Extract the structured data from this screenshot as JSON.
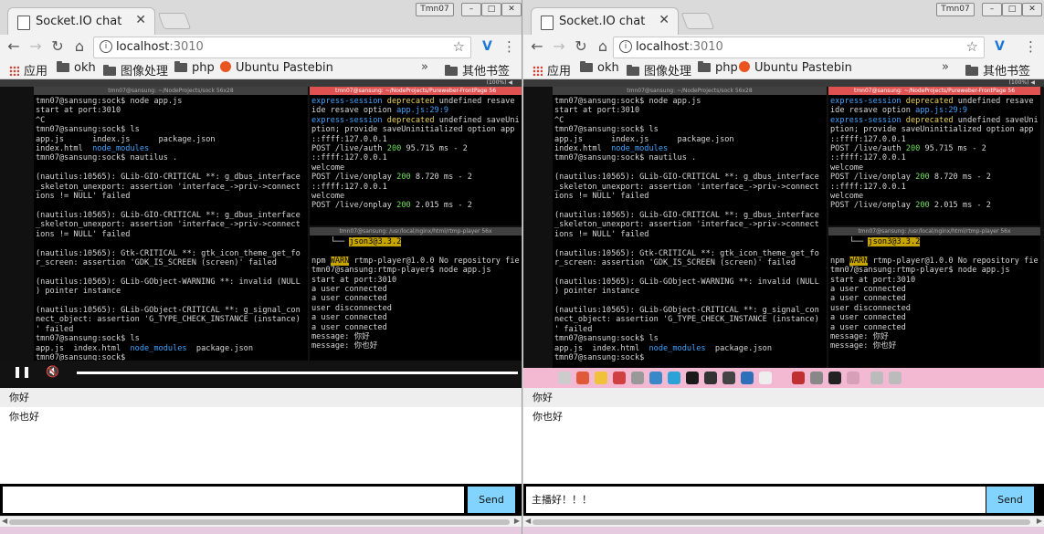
{
  "left": {
    "tab_title": "Socket.IO chat",
    "user": "Tmn07",
    "url_host": "localhost",
    "url_port": ":3010",
    "bookmarks": [
      "应用",
      "okh",
      "图像处理",
      "php",
      "Ubuntu Pastebin"
    ],
    "bookmarks_more": "»",
    "other_bookmarks": "其他书签",
    "video": {
      "term1_title": "tmn07@sansung: ~/NodeProjects/Pureweber-FrontPage",
      "term1_sub": "tmn07@sansung: ~/NodeProjects/sock 56x28",
      "term2_title": "tmn07@sansung: ~/NodeProjects/Pureweber-FrontPage 56",
      "term3_title": "tmn07@sansung: /usr/local/nginx/html/rtmp-player 56x",
      "clock": "(100%) ◀"
    },
    "messages": [
      "你好",
      "你也好"
    ],
    "input_value": "",
    "send_label": "Send"
  },
  "right": {
    "tab_title": "Socket.IO chat",
    "user": "Tmn07",
    "url_host": "localhost",
    "url_port": ":3010",
    "bookmarks": [
      "应用",
      "okh",
      "图像处理",
      "php",
      "Ubuntu Pastebin"
    ],
    "bookmarks_more": "»",
    "other_bookmarks": "其他书签",
    "video": {
      "term1_title": "tmn07@sansung: ~/NodeProjects/Pureweber-FrontPage",
      "term1_sub": "tmn07@sansung: ~/NodeProjects/sock 56x28",
      "term2_title": "tmn07@sansung: ~/NodeProjects/Pureweber-FrontPage 56",
      "term3_title": "tmn07@sansung: /usr/local/nginx/html/rtmp-player 56x",
      "clock": "(100%) ◀"
    },
    "messages": [
      "你好",
      "你也好"
    ],
    "input_value": "主播好！！！",
    "send_label": "Send"
  },
  "terminal": {
    "left_lines": [
      "tmn07@sansung:sock$ node app.js",
      "start at port:3010",
      "^C",
      "tmn07@sansung:sock$ ls",
      "app.js      index.js      package.json",
      "index.html  node_modules",
      "tmn07@sansung:sock$ nautilus .",
      "",
      "(nautilus:10565): GLib-GIO-CRITICAL **: g_dbus_interface",
      "_skeleton_unexport: assertion 'interface_->priv->connect",
      "ions != NULL' failed",
      "",
      "(nautilus:10565): GLib-GIO-CRITICAL **: g_dbus_interface",
      "_skeleton_unexport: assertion 'interface_->priv->connect",
      "ions != NULL' failed",
      "",
      "(nautilus:10565): Gtk-CRITICAL **: gtk_icon_theme_get_fo",
      "r_screen: assertion 'GDK_IS_SCREEN (screen)' failed",
      "",
      "(nautilus:10565): GLib-GObject-WARNING **: invalid (NULL",
      ") pointer instance",
      "",
      "(nautilus:10565): GLib-GObject-CRITICAL **: g_signal_con",
      "nect_object: assertion 'G_TYPE_CHECK_INSTANCE (instance)",
      "' failed",
      "tmn07@sansung:sock$ ls",
      "app.js  index.html  node_modules  package.json",
      "tmn07@sansung:sock$ "
    ],
    "right_top_lines": [
      "express-session deprecated undefined resave",
      "ide resave option app.js:29:9",
      "express-session deprecated undefined saveUni",
      "ption; provide saveUninitialized option app",
      "::ffff:127.0.0.1",
      "POST /live/auth 200 95.715 ms - 2",
      "::ffff:127.0.0.1",
      "welcome",
      "POST /live/onplay 200 8.720 ms - 2",
      "::ffff:127.0.0.1",
      "welcome",
      "POST /live/onplay 200 2.015 ms - 2"
    ],
    "right_bottom_lines": [
      "    └── json3@3.3.2",
      "",
      "npm WARN rtmp-player@1.0.0 No repository fie",
      "tmn07@sansung:rtmp-player$ node app.js",
      "start at port:3010",
      "a user connected",
      "a user connected",
      "user disconnected",
      "a user connected",
      "a user connected",
      "message: 你好",
      "message: 你也好"
    ]
  },
  "colors": {
    "send_button": "#82d4fe",
    "dock": "#f3b9d3",
    "favicon_ubuntu": "#e95420"
  }
}
